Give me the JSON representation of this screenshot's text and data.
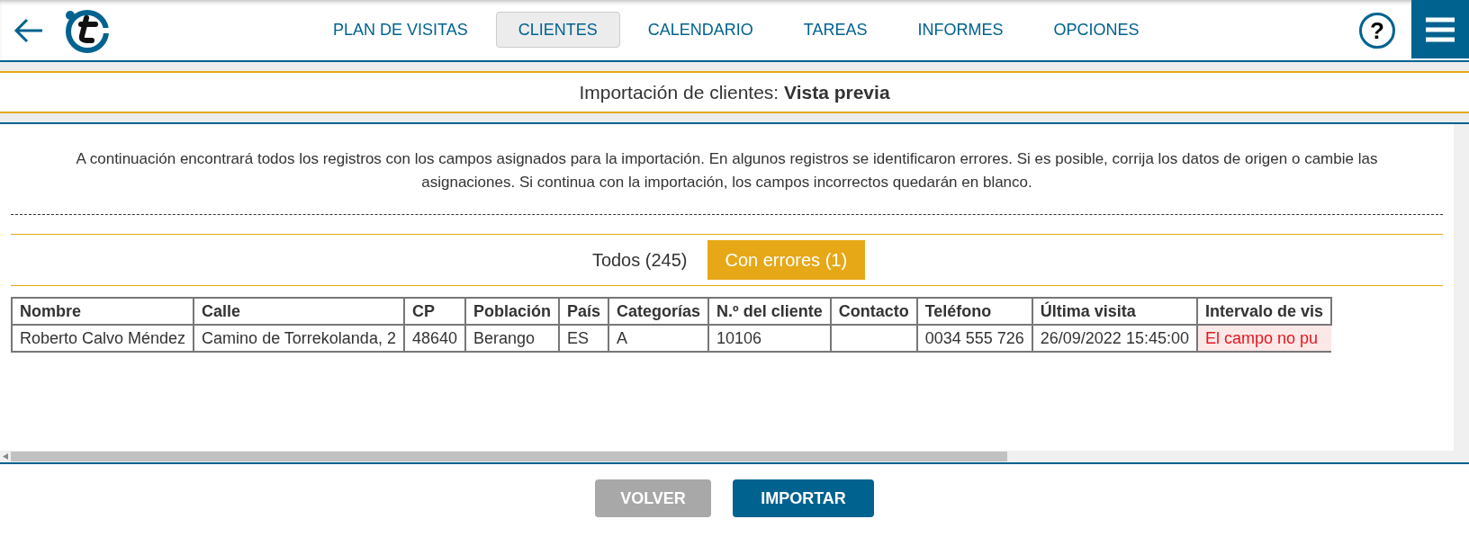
{
  "nav": [
    {
      "label": "PLAN DE VISITAS",
      "selected": false
    },
    {
      "label": "CLIENTES",
      "selected": true
    },
    {
      "label": "CALENDARIO",
      "selected": false
    },
    {
      "label": "TAREAS",
      "selected": false
    },
    {
      "label": "INFORMES",
      "selected": false
    },
    {
      "label": "OPCIONES",
      "selected": false
    }
  ],
  "help_icon": "?",
  "page_title": "Importación de clientes: **Vista previa**",
  "intro": "A continuación encontrará todos los registros con los campos asignados para la importación. En algunos registros se identificaron errores. Si es posible, corrija los datos de origen o cambie las asignaciones. Si continua con la importación, los campos incorrectos quedarán en blanco.",
  "filters": [
    {
      "label": "Todos (245)",
      "selected": false
    },
    {
      "label": "Con errores (1)",
      "selected": true
    }
  ],
  "table": {
    "columns": [
      "Nombre",
      "Calle",
      "CP",
      "Población",
      "País",
      "Categorías",
      "N.º del cliente",
      "Contacto",
      "Teléfono",
      "Última visita",
      "Intervalo de vis"
    ],
    "rows": [
      {
        "cells": [
          {
            "text": "Roberto Calvo Méndez",
            "error": false
          },
          {
            "text": "Camino de Torrekolanda, 2",
            "error": false
          },
          {
            "text": "48640",
            "error": false
          },
          {
            "text": "Berango",
            "error": false
          },
          {
            "text": "ES",
            "error": false
          },
          {
            "text": "A",
            "error": false
          },
          {
            "text": "10106",
            "error": false
          },
          {
            "error": false
          },
          {
            "text": "0034 555 726",
            "error": false
          },
          {
            "text": "26/09/2022 15:45:00",
            "error": false
          },
          {
            "text": "El campo no pu",
            "error": true
          }
        ]
      }
    ]
  },
  "buttons": [
    {
      "label": "VOLVER",
      "disabled": true
    },
    {
      "label": "IMPORTAR",
      "disabled": false
    }
  ]
}
